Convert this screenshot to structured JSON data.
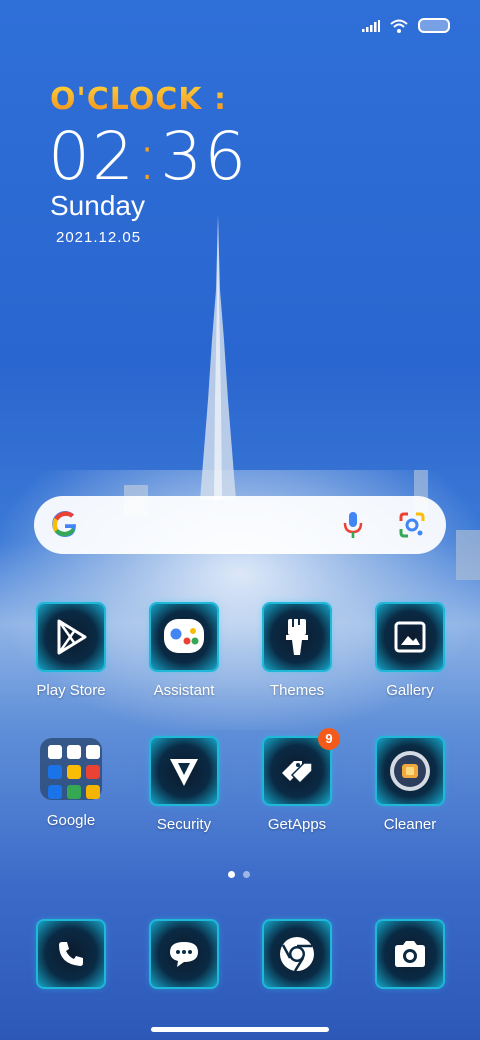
{
  "status_bar": {
    "signal_icon": "signal-icon",
    "wifi_icon": "wifi-icon",
    "battery_icon": "battery-icon"
  },
  "clock_widget": {
    "brand": "O'CLOCK :",
    "hours": "02",
    "minutes": "36",
    "day": "Sunday",
    "date": "2021.12.05"
  },
  "search_widget": {
    "logo_icon": "google-g-icon",
    "voice_icon": "microphone-icon",
    "lens_icon": "google-lens-icon"
  },
  "apps_row1": [
    {
      "label": "Play Store",
      "icon": "play-store-icon"
    },
    {
      "label": "Assistant",
      "icon": "assistant-icon"
    },
    {
      "label": "Themes",
      "icon": "paintbrush-icon"
    },
    {
      "label": "Gallery",
      "icon": "gallery-icon"
    }
  ],
  "apps_row2": [
    {
      "label": "Google",
      "icon": "folder-icon"
    },
    {
      "label": "Security",
      "icon": "security-icon"
    },
    {
      "label": "GetApps",
      "icon": "getapps-icon",
      "badge": "9"
    },
    {
      "label": "Cleaner",
      "icon": "cleaner-icon"
    }
  ],
  "dock": [
    {
      "icon": "phone-icon"
    },
    {
      "icon": "messages-icon"
    },
    {
      "icon": "chrome-icon"
    },
    {
      "icon": "camera-icon"
    }
  ],
  "page_indicator": {
    "pages": 2,
    "current": 1
  },
  "colors": {
    "accent_clock": "#f6a21c",
    "badge": "#f45a1a",
    "tile_glow": "#1fb8d8"
  }
}
